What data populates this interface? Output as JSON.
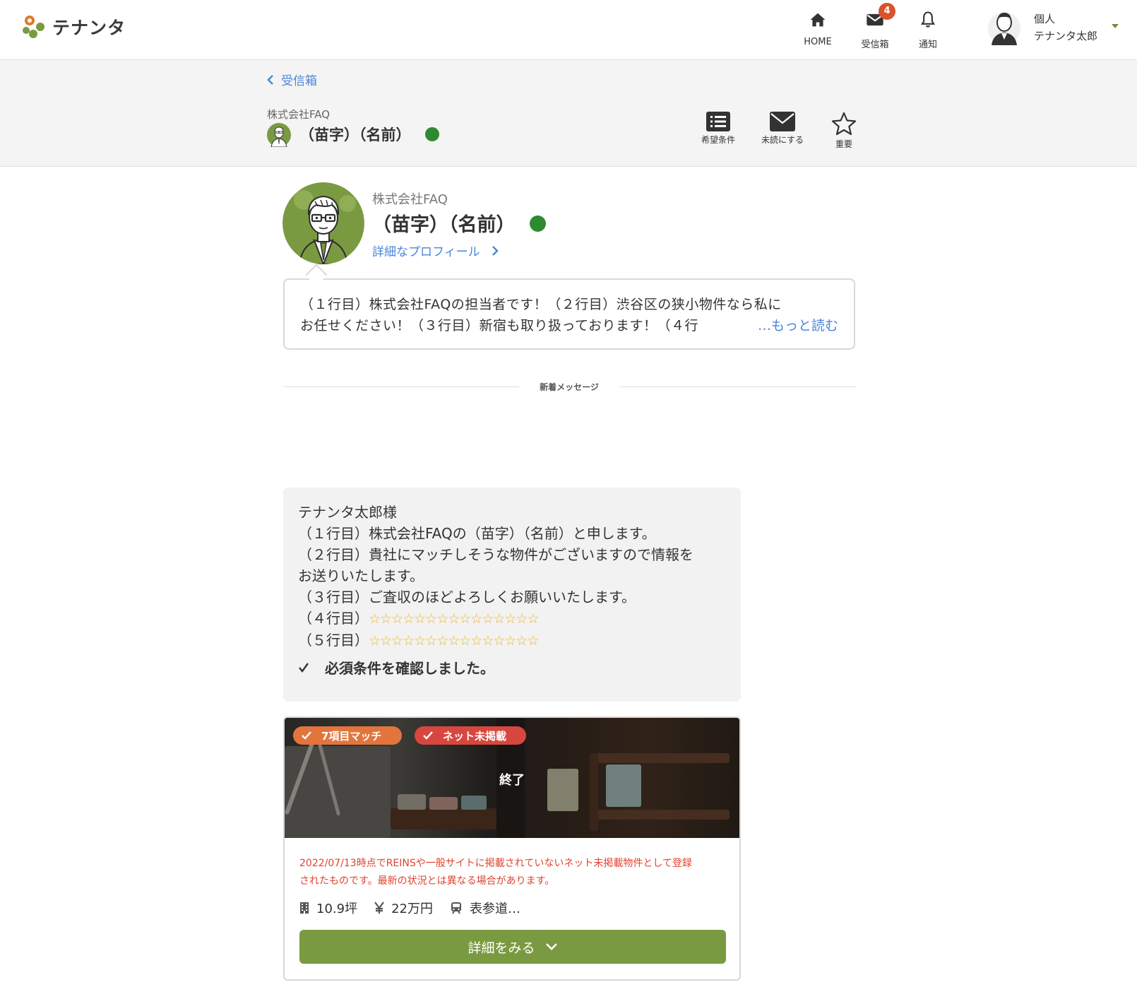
{
  "brand": {
    "logo_text": "テナンタ",
    "accent": "#7a9a41",
    "link": "#4a85d9",
    "badge": "#d9532c",
    "online": "#2e8a2e"
  },
  "nav": {
    "home_label": "HOME",
    "inbox_label": "受信箱",
    "inbox_badge": "4",
    "notice_label": "通知",
    "user_type": "個人",
    "user_name": "テナンタ太郎"
  },
  "header": {
    "back_label": "受信箱",
    "company": "株式会社FAQ",
    "name": "（苗字）（名前）",
    "actions": {
      "conditions": "希望条件",
      "unread": "未読にする",
      "important": "重要"
    }
  },
  "profile": {
    "company": "株式会社FAQ",
    "name": "（苗字）（名前）",
    "detail_link": "詳細なプロフィール",
    "bio_line1": "（１行目）株式会社FAQの担当者です！（２行目）渋谷区の狭小物件なら私に",
    "bio_line2": "お任せください！（３行目）新宿も取り扱っております！（４行",
    "more": "…もっと読む"
  },
  "divider_label": "新着メッセージ",
  "message": {
    "lines": [
      "テナンタ太郎様",
      "（１行目）株式会社FAQの（苗字）（名前）と申します。",
      "（２行目）貴社にマッチしそうな物件がございますので情報を",
      "お送りいたします。",
      "（３行目）ご査収のほどよろしくお願いいたします。"
    ],
    "star_prefix_4": "（４行目）",
    "star_prefix_5": "（５行目）",
    "stars": "☆☆☆☆☆☆☆☆☆☆☆☆☆☆☆",
    "confirm": "必須条件を確認しました。"
  },
  "property": {
    "tag_match": "7項目マッチ",
    "tag_offline": "ネット未掲載",
    "status": "終了",
    "warning_line1": "2022/07/13時点でREINSや一般サイトに掲載されていないネット未掲載物件として登録",
    "warning_line2": "されたものです。最新の状況とは異なる場合があります。",
    "area": "10.9坪",
    "rent": "22万円",
    "station": "表参道…",
    "detail_button": "詳細をみる"
  },
  "icons": [
    "home-icon",
    "mail-icon",
    "bell-icon",
    "user-avatar-icon",
    "chevron-left-icon",
    "list-icon",
    "envelope-icon",
    "star-icon",
    "chevron-right-icon",
    "check-icon",
    "building-icon",
    "yen-icon",
    "train-icon",
    "chevron-down-icon"
  ]
}
